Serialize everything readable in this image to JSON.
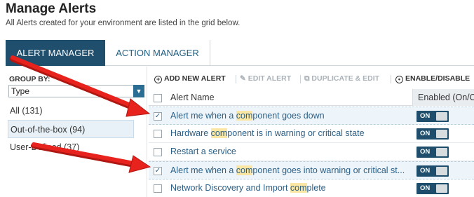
{
  "header": {
    "title": "Manage Alerts",
    "subtitle": "All Alerts created for your environment are listed in the grid below."
  },
  "tabs": [
    {
      "label": "ALERT MANAGER",
      "active": true
    },
    {
      "label": "ACTION MANAGER",
      "active": false
    }
  ],
  "sidebar": {
    "group_by_label": "GROUP BY:",
    "group_by_value": "Type",
    "items": [
      {
        "label": "All (131)",
        "selected": false
      },
      {
        "label": "Out-of-the-box (94)",
        "selected": true
      },
      {
        "label": "User-Defined (37)",
        "selected": false
      }
    ]
  },
  "toolbar": {
    "add_label": "ADD NEW ALERT",
    "edit_label": "EDIT ALERT",
    "duplicate_label": "DUPLICATE & EDIT",
    "enable_label": "ENABLE/DISABLE"
  },
  "grid": {
    "col_name": "Alert Name",
    "col_enabled": "Enabled (On/Off)",
    "rows": [
      {
        "pre": "Alert me when a ",
        "hl": "com",
        "post": "ponent goes down",
        "checked": true,
        "toggle": "ON"
      },
      {
        "pre": "Hardware ",
        "hl": "com",
        "post": "ponent is in warning or critical state",
        "checked": false,
        "toggle": "ON"
      },
      {
        "pre": "Restart a service",
        "hl": "",
        "post": "",
        "checked": false,
        "toggle": "ON"
      },
      {
        "pre": "Alert me when a ",
        "hl": "com",
        "post": "ponent goes into warning or critical st...",
        "checked": true,
        "toggle": "ON"
      },
      {
        "pre": "Network Discovery and Import ",
        "hl": "com",
        "post": "plete",
        "checked": false,
        "toggle": "ON"
      }
    ]
  },
  "colors": {
    "accent": "#204f6e",
    "link": "#2b5f86",
    "highlight": "#fbe7a3",
    "arrow": "#e8231d"
  },
  "icons": {
    "add": "plus-circle-icon",
    "edit": "pencil-icon",
    "duplicate": "duplicate-icon",
    "enable": "power-icon",
    "dropdown": "chevron-down-icon",
    "check": "checkmark-icon",
    "annotation": "red-arrow-icon"
  }
}
